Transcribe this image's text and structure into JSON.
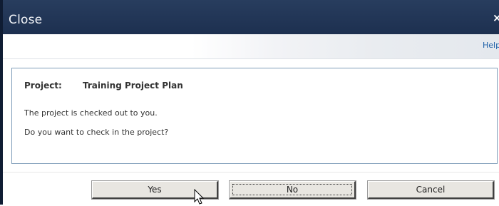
{
  "dialog": {
    "title": "Close",
    "close_glyph": "×",
    "help_label": "Help"
  },
  "content": {
    "project_label": "Project:",
    "project_name": "Training Project Plan",
    "message_line1": "The project is checked out to you.",
    "message_line2": "Do you want to check in the project?"
  },
  "buttons": {
    "yes": "Yes",
    "no": "No",
    "cancel": "Cancel"
  },
  "colors": {
    "titlebar": "#1d3050",
    "help_link": "#1e5fa8",
    "content_border": "#7f9db9"
  }
}
